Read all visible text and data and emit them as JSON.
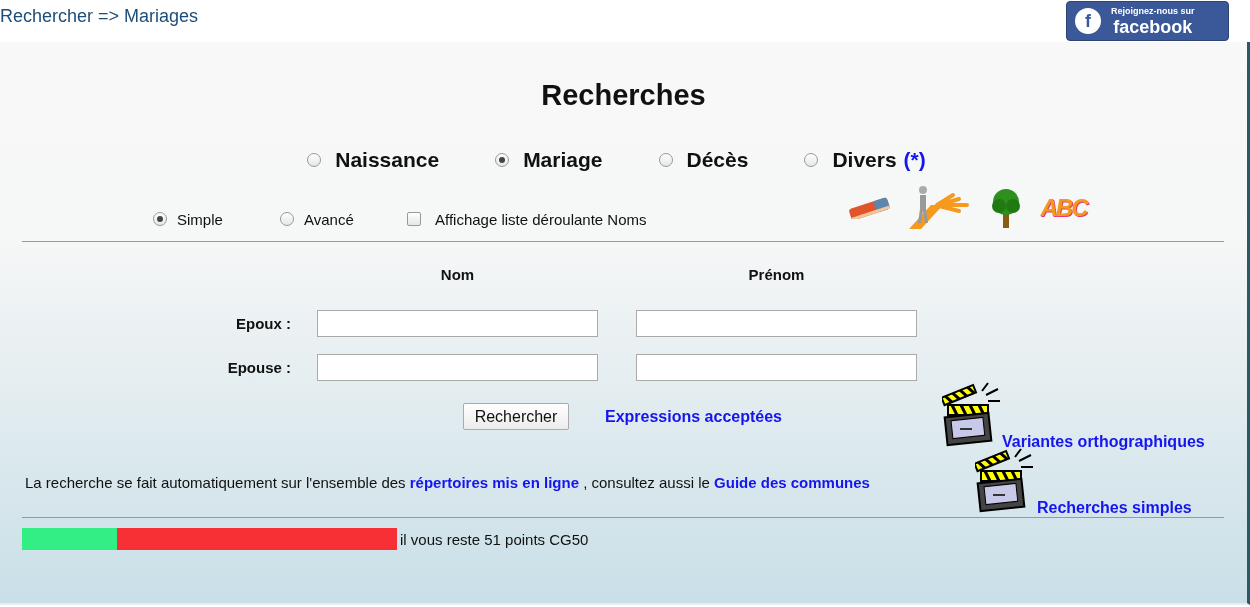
{
  "breadcrumb": "Rechercher => Mariages",
  "facebook_button": {
    "icon_letter": "f",
    "small_text": "Rejoignez-nous sur",
    "brand": "facebook"
  },
  "title": "Recherches",
  "record_types": [
    {
      "label": "Naissance",
      "selected": false
    },
    {
      "label": "Mariage",
      "selected": true
    },
    {
      "label": "Décès",
      "selected": false
    },
    {
      "label": "Divers",
      "note": "(*)",
      "selected": false
    }
  ],
  "search_modes": [
    {
      "label": "Simple",
      "selected": true
    },
    {
      "label": "Avancé",
      "selected": false
    }
  ],
  "dropdown_option": {
    "label": "Affichage liste déroulante Noms",
    "checked": false
  },
  "letters_icon": "ABC",
  "columns": [
    "Nom",
    "Prénom"
  ],
  "rows": [
    {
      "label": "Epoux :"
    },
    {
      "label": "Epouse :"
    }
  ],
  "search_button": "Rechercher",
  "expressions_link": "Expressions acceptées",
  "variants_link": "Variantes orthographiques",
  "info": {
    "text_before": "La recherche se fait automatiquement sur l'ensemble des ",
    "link_1": "répertoires mis en ligne",
    "text_middle": " , consultez aussi le ",
    "link_2": "Guide des communes"
  },
  "simple_link": "Recherches simples",
  "points": {
    "level": 0.253,
    "text": "il vous reste 51 points CG50"
  }
}
